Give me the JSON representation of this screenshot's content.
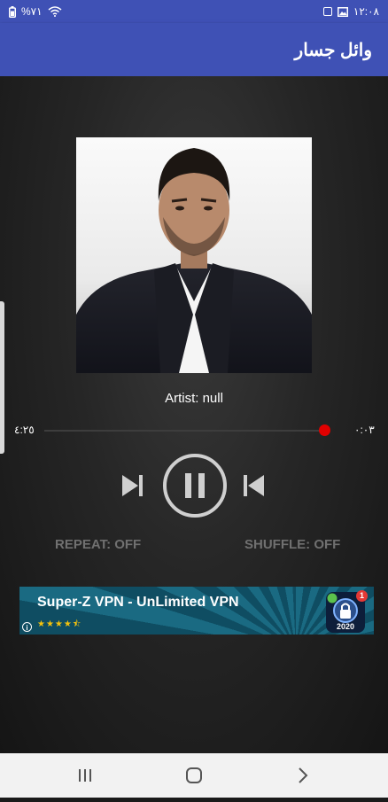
{
  "status_bar": {
    "battery": "%٧١",
    "time": "١٢:٠٨",
    "icons": [
      "battery-icon",
      "wifi-icon",
      "gallery-icon",
      "notification-icon"
    ]
  },
  "app_bar": {
    "title": "وائل جسار"
  },
  "player": {
    "artist": "Artist: null",
    "time_left": "٤:٢٥",
    "time_right": "٠:٠٣",
    "repeat": "REPEAT: OFF",
    "shuffle": "SHUFFLE: OFF",
    "seek_accent": "#e00000",
    "controls": [
      "skip-next-icon",
      "pause-icon",
      "skip-previous-icon"
    ]
  },
  "ad": {
    "title": "Super-Z VPN - UnLimited VPN",
    "stars": "★★★★⯪",
    "year": "2020",
    "badge": "1",
    "info": "i"
  },
  "nav": {
    "icons": [
      "recent-apps-icon",
      "home-icon",
      "back-icon"
    ]
  },
  "colors": {
    "app_bar": "#3f51b5",
    "ad_bg": "#1a6a82"
  }
}
